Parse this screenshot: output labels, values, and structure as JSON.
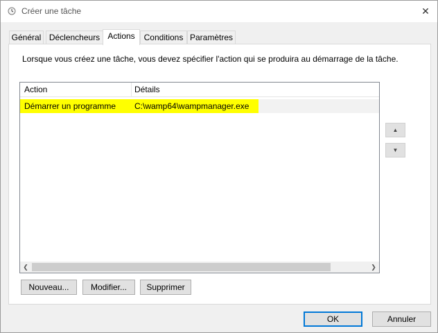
{
  "window": {
    "title": "Créer une tâche"
  },
  "tabs": [
    {
      "label": "Général"
    },
    {
      "label": "Déclencheurs"
    },
    {
      "label": "Actions"
    },
    {
      "label": "Conditions"
    },
    {
      "label": "Paramètres"
    }
  ],
  "actions_tab": {
    "intro": "Lorsque vous créez une tâche, vous devez spécifier l'action qui se produira au démarrage de la tâche.",
    "columns": {
      "action": "Action",
      "details": "Détails"
    },
    "rows": [
      {
        "action": "Démarrer un programme",
        "details": "C:\\wamp64\\wampmanager.exe"
      }
    ],
    "buttons": {
      "new": "Nouveau...",
      "edit": "Modifier...",
      "delete": "Supprimer"
    }
  },
  "dialog_buttons": {
    "ok": "OK",
    "cancel": "Annuler"
  },
  "icons": {
    "title": "clock-icon",
    "close": "close-icon",
    "move_up": "arrow-up-icon",
    "move_down": "arrow-down-icon"
  },
  "colors": {
    "highlight": "#ffff00",
    "default_button_border": "#0078d7"
  }
}
